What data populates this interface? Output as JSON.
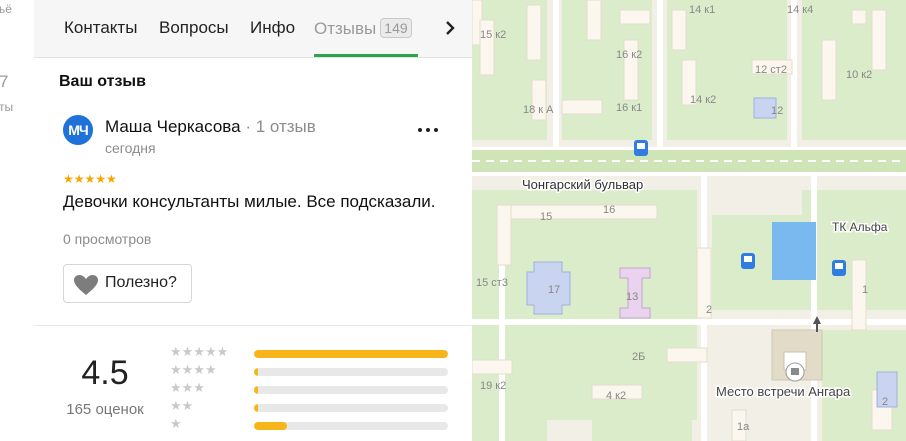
{
  "left_strip": {
    "texts": [
      "ьё",
      "7",
      "ты"
    ]
  },
  "tabs": [
    {
      "label": "Контакты"
    },
    {
      "label": "Вопросы"
    },
    {
      "label": "Инфо"
    },
    {
      "label": "Отзывы",
      "count": "149"
    }
  ],
  "tab_next_icon": "chevron-right-icon",
  "review": {
    "section_title": "Ваш отзыв",
    "avatar_initials": "МЧ",
    "avatar_color": "#1e72d8",
    "author": "Маша Черкасова",
    "author_separator": "·",
    "author_reviews": "1 отзыв",
    "date": "сегодня",
    "stars": 5,
    "stars_glyphs": "★★★★★",
    "text": "Девочки консультанты милые. Все подсказали.",
    "views": "0 просмотров",
    "useful_label": "Полезно?",
    "useful_icon": "heart-icon",
    "more_icon": "more-icon"
  },
  "rating": {
    "value": "4.5",
    "count_label": "165 оценок",
    "distribution": [
      {
        "stars": 5,
        "glyphs": "★★★★★",
        "fraction": 1.0
      },
      {
        "stars": 4,
        "glyphs": "★★★★",
        "fraction": 0.02
      },
      {
        "stars": 3,
        "glyphs": "★★★",
        "fraction": 0.02
      },
      {
        "stars": 2,
        "glyphs": "★★",
        "fraction": 0.02
      },
      {
        "stars": 1,
        "glyphs": "★",
        "fraction": 0.17
      }
    ],
    "bar_color": "#f7b519"
  },
  "map": {
    "street": "Чонгарский бульвар",
    "poi_tk": "ТК Альфа",
    "poi_angara": "Место встречи Ангара",
    "labels": [
      "14 к1",
      "14 к4",
      "15 к2",
      "16 к2",
      "12 ст2",
      "10 к2",
      "18 к А",
      "16 к1",
      "14 к2",
      "12",
      "15",
      "16",
      "15 ст3",
      "17",
      "13",
      "2",
      "2Б",
      "19 к2",
      "4 к2",
      "1а",
      "1",
      "2"
    ],
    "colors": {
      "land": "#f2efe6",
      "green": "#dbeccb",
      "building": "#fbf7ee",
      "water": "#7ab8f0",
      "bus": "#2f7de1"
    }
  }
}
